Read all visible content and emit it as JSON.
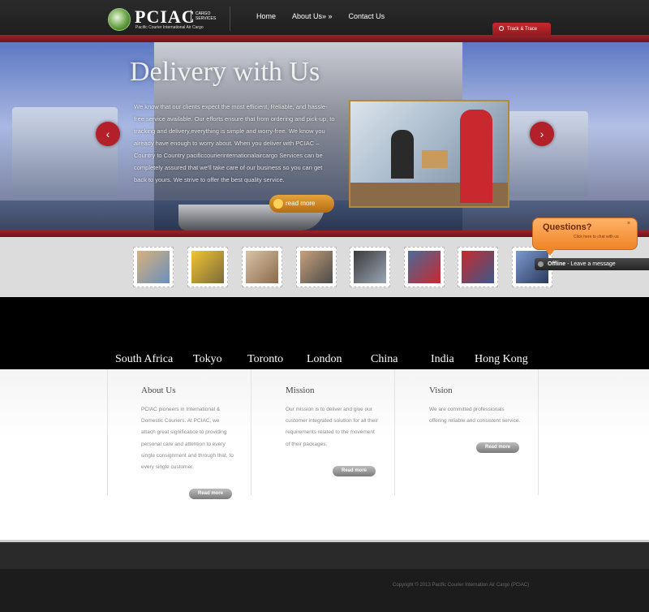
{
  "header": {
    "logo_text": "PCIAC",
    "logo_subtitle": "Pacific Courier International Air Cargo",
    "logo_tag": "CARGO SERVICES",
    "nav": [
      "Home",
      "About Us» »",
      "Contact Us"
    ],
    "track_label": "Track & Trace"
  },
  "hero": {
    "title": "Delivery with Us",
    "text": "We know that our clients expect the most efficient, Reliable, and hassle-free service available. Our efforts ensure that from ordering and pick-up, to tracking and delivery,everything is simple and worry-free. We know you already have enough to worry about. When you deliver with PCIAC – Country to Country pacificcourierinternationalaircargo Services can be completely assured that we'll take care of our business so you can get back to yours. We strive to offer the best quality service.",
    "readmore": "read more",
    "arrow_left": "‹",
    "arrow_right": "›"
  },
  "thumbnails": [
    {
      "name": "globe-boxes",
      "colors": [
        "#d7b27a",
        "#6a8fbd"
      ]
    },
    {
      "name": "warning-sign",
      "colors": [
        "#f2c530",
        "#7a6a3a"
      ]
    },
    {
      "name": "airport",
      "colors": [
        "#d9c4a8",
        "#8a6a4a"
      ]
    },
    {
      "name": "office-delivery",
      "colors": [
        "#c8a27a",
        "#4a4a4a"
      ]
    },
    {
      "name": "airplane-logo",
      "colors": [
        "#3a3a3a",
        "#9aa6b5"
      ]
    },
    {
      "name": "container-port",
      "colors": [
        "#4a6a9a",
        "#c9292e"
      ]
    },
    {
      "name": "containers",
      "colors": [
        "#c9292e",
        "#3a5a8a"
      ]
    },
    {
      "name": "ship",
      "colors": [
        "#7d9ad0",
        "#2a3a5a"
      ]
    }
  ],
  "chat": {
    "title": "Questions?",
    "subtitle": "Click here to chat with us",
    "close": "×",
    "status": "Offline",
    "status_text": " - Leave a message"
  },
  "cities": [
    "South Africa",
    "Tokyo",
    "Toronto",
    "London",
    "China",
    "India",
    "Hong Kong"
  ],
  "columns": [
    {
      "title": "About Us",
      "text": "PCIAC pioneers in International & Domestic Couriers. At PCIAC, we attach great significance to providing personal care and attention to every single consignment and through that, to every single customer.",
      "button": "Read more"
    },
    {
      "title": "Mission",
      "text": "Our mission is to deliver and give our customer integrated solution for all their requirements related to the movement of their packages.",
      "button": "Read more"
    },
    {
      "title": "Vision",
      "text": "We are committed professionals offering reliable and consistent service.",
      "button": "Read more"
    }
  ],
  "footer": {
    "copyright": "Copyright © 2013 Pacific Courier Internation Air Cargo (PCIAC)"
  },
  "colors": {
    "accent_red": "#9a2228",
    "readmore_orange": "#e5a33a",
    "chat_orange": "#f08426"
  }
}
